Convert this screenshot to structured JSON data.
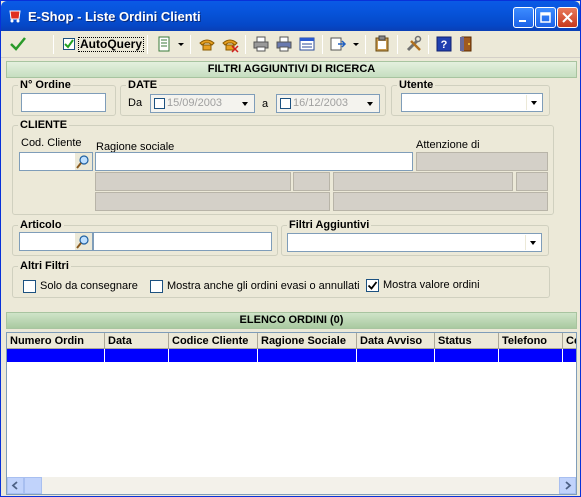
{
  "window": {
    "title": "E-Shop - Liste Ordini Clienti"
  },
  "toolbar": {
    "autoquery_label": "AutoQuery",
    "autoquery_checked": true
  },
  "filters_header": "FILTRI AGGIUNTIVI DI RICERCA",
  "ordine": {
    "legend": "N° Ordine",
    "value": ""
  },
  "date": {
    "legend": "DATE",
    "from_label": "Da",
    "from_value": "15/09/2003",
    "to_label": "a",
    "to_value": "16/12/2003"
  },
  "utente": {
    "legend": "Utente",
    "value": ""
  },
  "cliente": {
    "legend": "CLIENTE",
    "cod_label": "Cod. Cliente",
    "ragione_label": "Ragione sociale",
    "attenzione_label": "Attenzione di"
  },
  "articolo": {
    "legend": "Articolo"
  },
  "filtri_aggiuntivi": {
    "legend": "Filtri Aggiuntivi",
    "value": ""
  },
  "altri_filtri": {
    "legend": "Altri Filtri",
    "options": [
      {
        "label": "Solo da consegnare",
        "checked": false
      },
      {
        "label": "Mostra anche gli ordini evasi o annullati",
        "checked": false
      },
      {
        "label": "Mostra valore ordini",
        "checked": true
      }
    ]
  },
  "list_header": "ELENCO ORDINI (0)",
  "grid": {
    "columns": [
      "Numero Ordin",
      "Data",
      "Codice Cliente",
      "Ragione Sociale",
      "Data Avviso",
      "Status",
      "Telefono",
      "Ce"
    ]
  }
}
